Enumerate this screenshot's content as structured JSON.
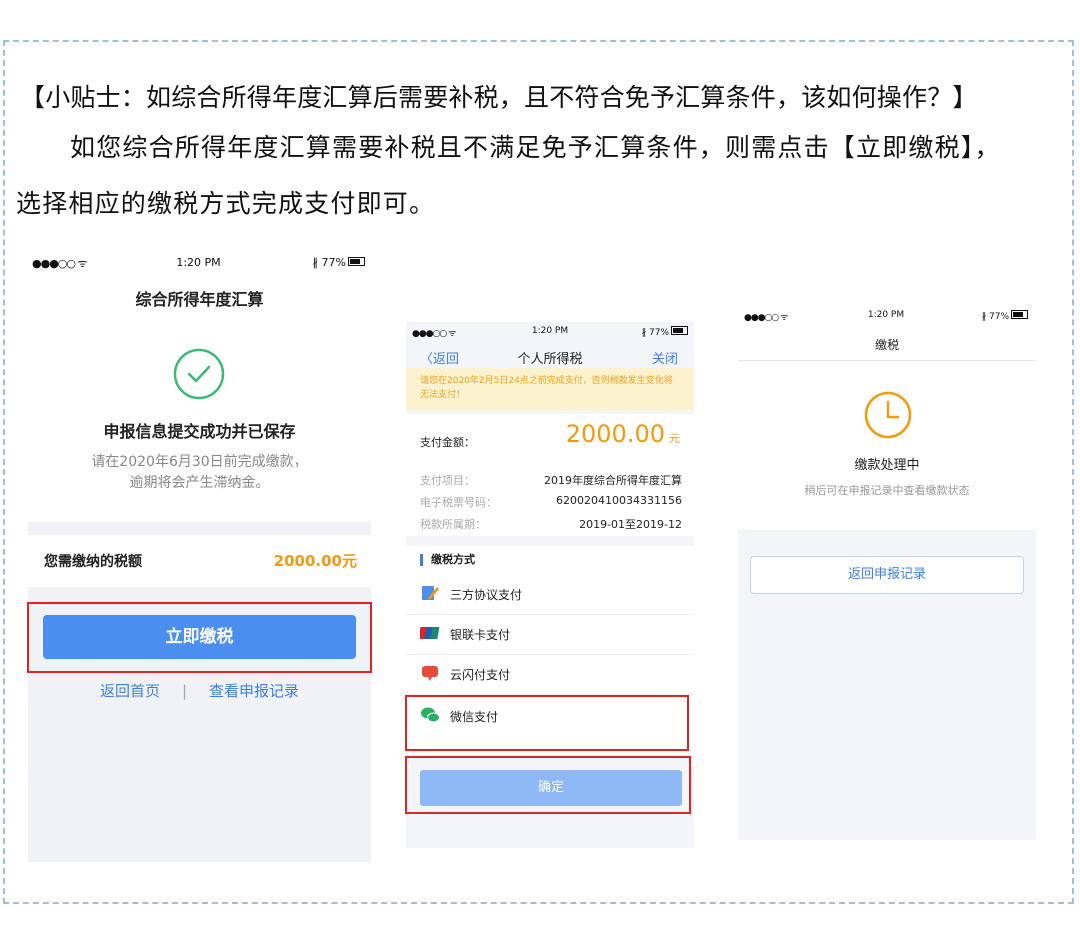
{
  "doc": {
    "title": "【小贴士：如综合所得年度汇算后需要补税，且不符合免予汇算条件，该如何操作？】",
    "para_line1": "如您综合所得年度汇算需要补税且不满足免予汇算条件，则需点击【立即缴税】，",
    "para_line2": "选择相应的缴税方式完成支付即可。"
  },
  "phone1": {
    "status": {
      "signal": "●●●○○ ᯤ",
      "time": "1:20 PM",
      "battery": "∦ 77%"
    },
    "header": "综合所得年度汇算",
    "success_title": "申报信息提交成功并已保存",
    "success_note_1": "请在2020年6月30日前完成缴款，",
    "success_note_2": "逾期将会产生滞纳金。",
    "tax_label": "您需缴纳的税额",
    "tax_value": "2000.00元",
    "pay_button": "立即缴税",
    "link_home": "返回首页",
    "link_sep": "|",
    "link_records": "查看申报记录"
  },
  "phone2": {
    "status": {
      "signal": "●●●○○ ᯤ",
      "time": "1:20 PM",
      "battery": "∦ 77%"
    },
    "back": "〈返回",
    "title": "个人所得税",
    "close": "关闭",
    "notice": "请您在2020年2月5日24点之前完成支付，否则税款发生变化将无法支付！",
    "amount_label": "支付金额：",
    "amount_value": "2000.00",
    "amount_unit": "元",
    "item_label": "支付项目：",
    "item_value": "2019年度综合所得年度汇算",
    "ticket_label": "电子税票号码：",
    "ticket_value": "620020410034331156",
    "period_label": "税款所属期：",
    "period_value": "2019-01至2019-12",
    "methods_header": "缴税方式",
    "methods": [
      "三方协议支付",
      "银联卡支付",
      "云闪付支付",
      "微信支付"
    ],
    "confirm": "确定"
  },
  "phone3": {
    "status": {
      "signal": "●●●○○ ᯤ",
      "time": "1:20 PM",
      "battery": "∦ 77%"
    },
    "header": "缴税",
    "status_title": "缴款处理中",
    "status_note": "稍后可在申报记录中查看缴款状态",
    "back_button": "返回申报记录"
  },
  "colors": {
    "accent_blue": "#4a8ff0",
    "orange": "#f39a10",
    "green": "#3cb878",
    "highlight_red": "#e02424",
    "frame": "#9fbfdf"
  }
}
